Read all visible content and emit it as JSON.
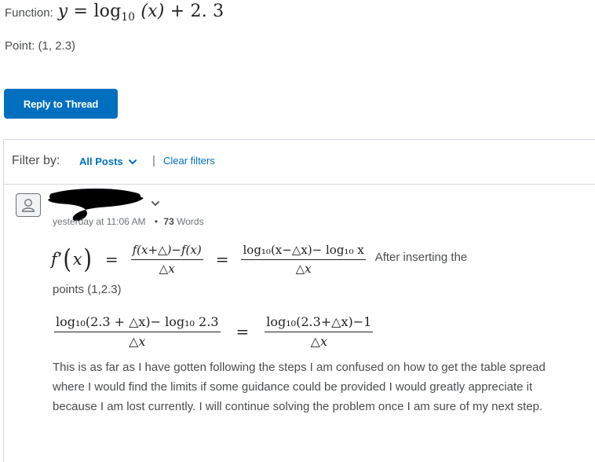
{
  "question": {
    "function_label": "Function:",
    "function_y": "y",
    "function_eq": "=",
    "function_log": "log",
    "function_base": "10",
    "function_arg": "(x)",
    "function_plus": "+ 2. 3",
    "point_text": "Point: (1, 2.3)"
  },
  "reply_button": {
    "label": "Reply to Thread"
  },
  "filter_bar": {
    "label": "Filter by:",
    "selected": "All Posts",
    "separator": "|",
    "clear_label": "Clear filters"
  },
  "post": {
    "timestamp": "yesterday at 11:06 AM",
    "bullet": "•",
    "word_count": "73",
    "words_label": "Words",
    "eq1": {
      "f": "f",
      "prime": "’",
      "x": "x",
      "num1": "f(x+△)−f(x)",
      "den1": "△x",
      "num2": "log₁₀(x−△x)− log₁₀ x",
      "den2": "△x",
      "equals": "="
    },
    "after_text": "After inserting the",
    "points_text": "points (1,2.3)",
    "eq2": {
      "num1": "log₁₀(2.3 + △x)− log₁₀ 2.3",
      "den1": "△x",
      "num2": "log₁₀(2.3+△x)−1",
      "den2": "△x",
      "equals": "="
    },
    "body": "This is as far as I have gotten following the steps I am confused on how to get the table spread where I would find the limits if some guidance could be provided I would greatly appreciate it because I am lost currently. I will continue solving the problem once I am sure of my next step."
  }
}
